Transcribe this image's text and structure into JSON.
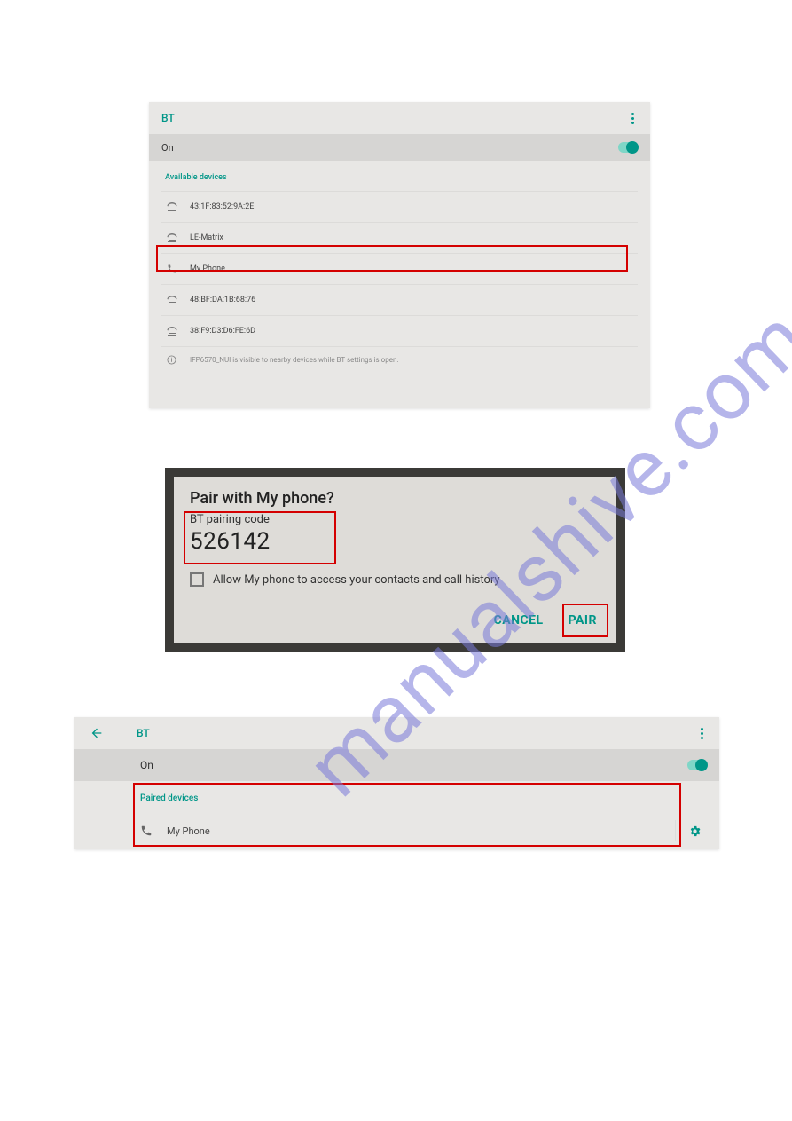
{
  "watermark": "manualshive.com",
  "screen1": {
    "title": "BT",
    "on_label": "On",
    "available_hdr": "Available devices",
    "devices": [
      "43:1F:83:52:9A:2E",
      "LE-Matrix",
      "My Phone",
      "48:BF:DA:1B:68:76",
      "38:F9:D3:D6:FE:6D"
    ],
    "info_text": "IFP6570_NUI is visible to nearby devices while BT settings is open."
  },
  "dialog": {
    "title": "Pair with My phone?",
    "subtitle": "BT pairing code",
    "code": "526142",
    "checkbox_label": "Allow My phone to access your contacts and call history",
    "cancel": "CANCEL",
    "pair": "PAIR"
  },
  "screen3": {
    "title": "BT",
    "on_label": "On",
    "paired_hdr": "Paired devices",
    "device": "My Phone"
  }
}
